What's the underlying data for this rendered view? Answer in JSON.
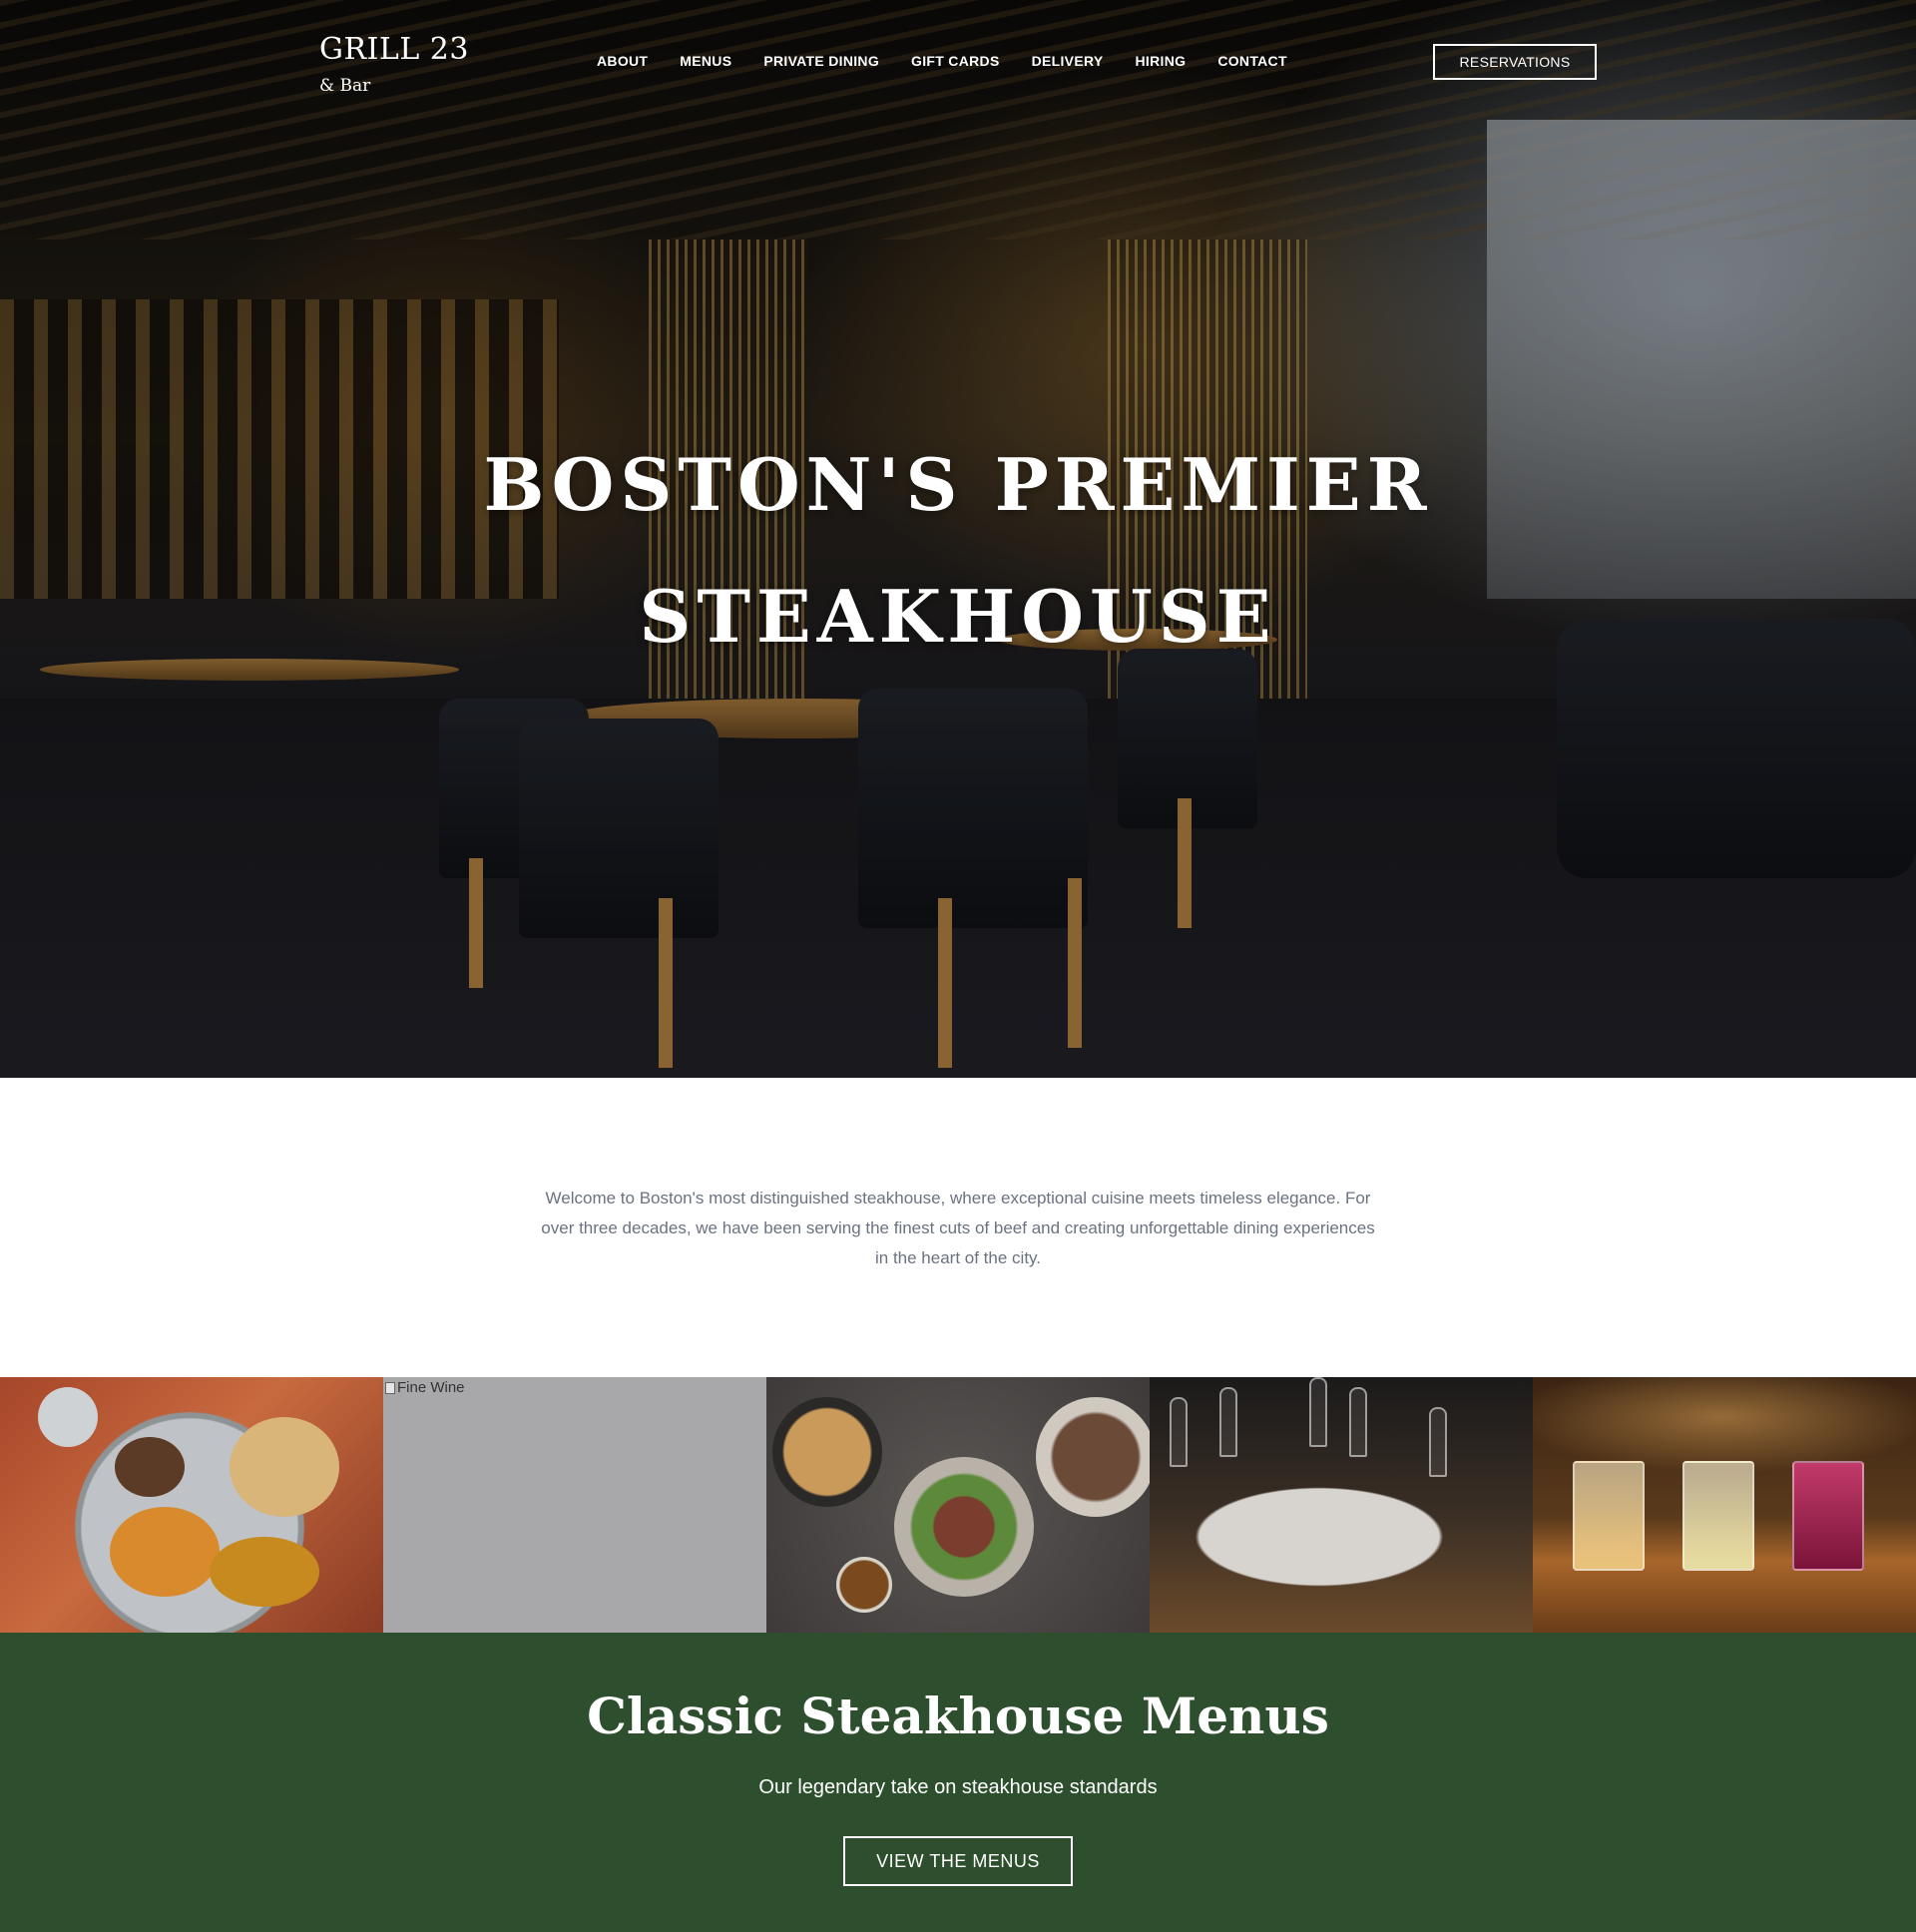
{
  "brand": {
    "name": "GRILL 23",
    "tagline": "& Bar"
  },
  "nav": {
    "items": [
      {
        "label": "ABOUT"
      },
      {
        "label": "MENUS"
      },
      {
        "label": "PRIVATE DINING"
      },
      {
        "label": "GIFT CARDS"
      },
      {
        "label": "DELIVERY"
      },
      {
        "label": "HIRING"
      },
      {
        "label": "CONTACT"
      }
    ],
    "cta_label": "RESERVATIONS"
  },
  "hero": {
    "title_line1": "BOSTON'S PREMIER",
    "title_line2": "STEAKHOUSE"
  },
  "intro": {
    "text": "Welcome to Boston's most distinguished steakhouse, where exceptional cuisine meets timeless elegance. For over three decades, we have been serving the finest cuts of beef and creating unforgettable dining experiences in the heart of the city."
  },
  "gallery": {
    "broken_image_alt": "Fine Wine"
  },
  "menus_section": {
    "title": "Classic Steakhouse Menus",
    "subtitle": "Our legendary take on steakhouse standards",
    "button_label": "VIEW THE MENUS",
    "background_color": "#2d4f2e"
  }
}
